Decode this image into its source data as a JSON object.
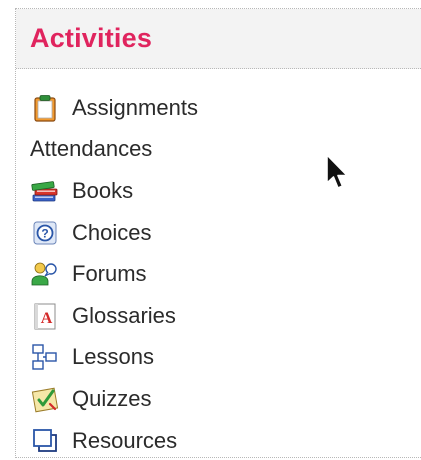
{
  "block": {
    "title": "Activities",
    "items": [
      {
        "label": "Assignments",
        "icon": "assignment-icon"
      },
      {
        "label": "Attendances",
        "icon": ""
      },
      {
        "label": "Books",
        "icon": "books-icon"
      },
      {
        "label": "Choices",
        "icon": "choice-icon"
      },
      {
        "label": "Forums",
        "icon": "forum-icon"
      },
      {
        "label": "Glossaries",
        "icon": "glossary-icon"
      },
      {
        "label": "Lessons",
        "icon": "lesson-icon"
      },
      {
        "label": "Quizzes",
        "icon": "quiz-icon"
      },
      {
        "label": "Resources",
        "icon": "resource-icon"
      }
    ]
  },
  "colors": {
    "title": "#e0245e",
    "header_bg": "#f3f3f3",
    "text": "#2b2b2b"
  }
}
